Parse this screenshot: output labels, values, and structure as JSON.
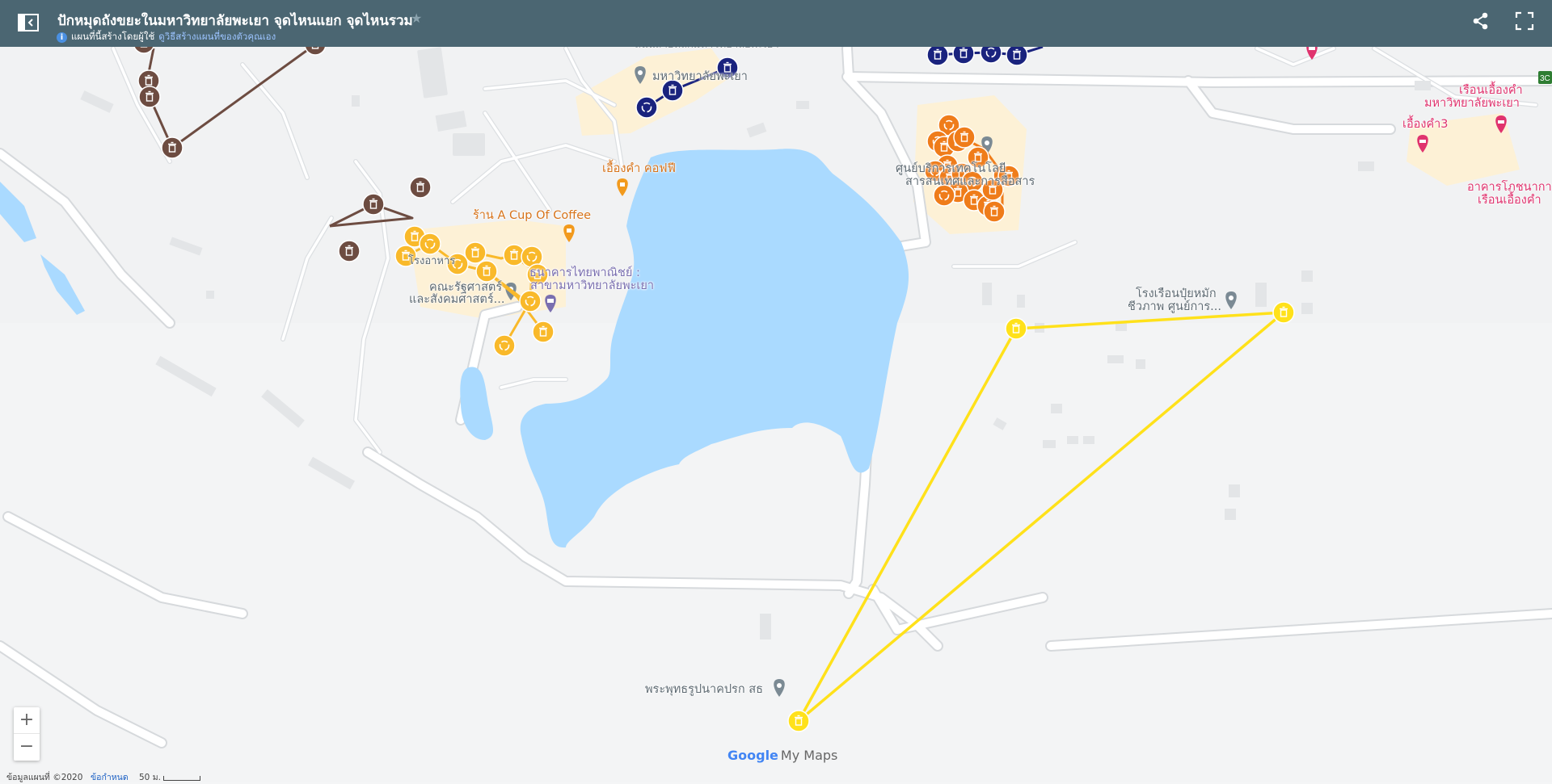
{
  "header": {
    "title": "ปักหมุดถังขยะในมหาวิทยาลัยพะเยา จุดไหนแยก จุดไหนรวม",
    "subtitle": "แผนที่นี้สร้างโดยผู้ใช้",
    "subtitle_link": "ดูวิธีสร้างแผนที่ของตัวคุณเอง",
    "info_icon_glyph": "i",
    "star_glyph": "★"
  },
  "labels": {
    "cafe": "เอื้องคำ คอฟฟี",
    "coffee": "ร้าน A Cup Of Coffee",
    "university": "มหาวิทยาลัยพะเยา",
    "faculty_1": "คณะรัฐศาสตร์",
    "faculty_2": "และสังคมศาสตร์...",
    "bank_1": "ธนาคารไทยพาณิชย์ :",
    "bank_2": "สาขามหาวิทยาลัยพะเยา",
    "canteen_fragment": "โรงอาหาร",
    "center_1": "ศูนย์บริการเทคโนโลยี",
    "center_2": "สารสนเทศและการสื่อสาร",
    "compost_1": "โรงเรือนปุ๋ยหมัก",
    "compost_2": "ชีวภาพ ศูนย์การ...",
    "buddha": "พระพุทธรูปนาคปรก สธ",
    "dorm_1": "เรือนเอื้องคำ",
    "dorm_2": "มหาวิทยาลัยพะเยา",
    "dorm_3": "เอื้องคำ3",
    "canteen_1": "อาคารโภชนาการ",
    "canteen_2": "เรือนเอื้องคำ",
    "route_shield": "3C",
    "top_cut_label": "ถนนสายหลักมหาวิทยาลัยพะเยา"
  },
  "layers": [
    {
      "name": "brown",
      "color": "#6d4c41"
    },
    {
      "name": "navy",
      "color": "#1a237e"
    },
    {
      "name": "gold",
      "color": "#f9b92a"
    },
    {
      "name": "orange",
      "color": "#ef7c1a"
    },
    {
      "name": "yellow",
      "color": "#ffe11a"
    }
  ],
  "colors": {
    "topbar": "#4b6672",
    "water": "#aadaff",
    "campus_area": "#fdf1d6",
    "road_fill": "#ffffff",
    "road_edge": "#d6d9dc"
  },
  "controls": {
    "zoom_in": "+",
    "zoom_out": "−"
  },
  "footer": {
    "map_data": "ข้อมูลแผนที่ ©2020",
    "terms": "ข้อกำหนด",
    "scale": "50 ม."
  },
  "branding": {
    "google": "Google",
    "product": "My Maps"
  }
}
